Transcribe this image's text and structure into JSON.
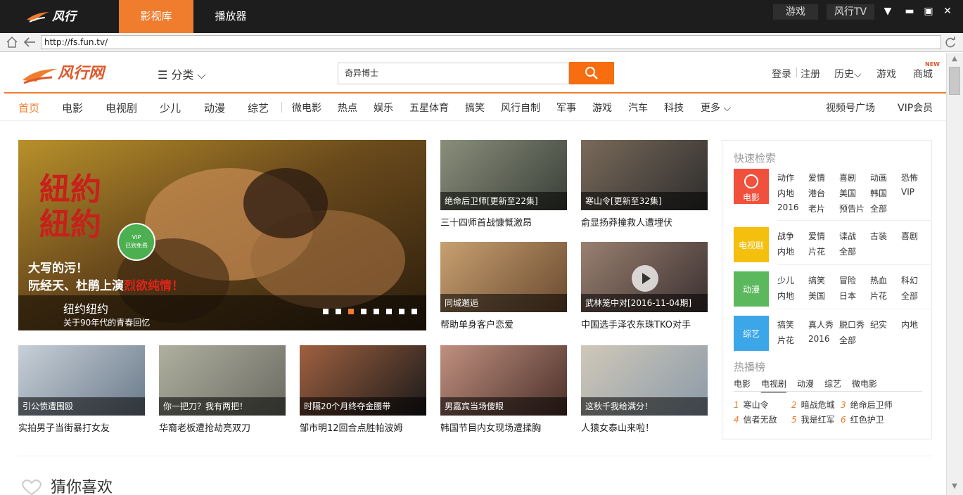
{
  "app": {
    "logo_text": "风行",
    "tabs": [
      "影视库",
      "播放器"
    ],
    "buttons": {
      "game": "游戏",
      "tv": "风行TV"
    }
  },
  "address": {
    "url": "http://fs.fun.tv/"
  },
  "site": {
    "logo_text": "风行网",
    "category_label": "☰ 分类 ⌵",
    "search_value": "奇异博士",
    "header_links": [
      "登录",
      "注册",
      "历史⌵",
      "游戏",
      "商城"
    ],
    "new_badge": "NEW",
    "nav_main": [
      "首页",
      "电影",
      "电视剧",
      "少儿",
      "动漫",
      "综艺"
    ],
    "nav_sub": [
      "微电影",
      "热点",
      "娱乐",
      "五星体育",
      "搞笑",
      "风行自制",
      "军事",
      "游戏",
      "汽车",
      "科技",
      "更多 ⌵"
    ],
    "nav_right": [
      "视频号广场",
      "VIP会员"
    ]
  },
  "hero": {
    "title": "纽约纽约",
    "subtitle": "关于90年代的青春回忆",
    "overlay_title": "紐約紐約",
    "overlay_text_1": "大写的污！",
    "overlay_text_2": "阮经天、杜鹃上演",
    "overlay_text_3": "烈欲纯情！",
    "vip_badge": "VIP 已到免费",
    "slide_count": 8,
    "active_slide": 3
  },
  "cards": [
    {
      "caption": "绝命后卫师[更新至22集]",
      "title": "三十四师首战慷慨激昂"
    },
    {
      "caption": "寒山令[更新至32集]",
      "title": "俞显扬莽撞救人遭埋伏"
    },
    {
      "caption": "同城邂逅",
      "title": "帮助单身客户恋爱"
    },
    {
      "caption": "武林笼中对[2016-11-04期]",
      "title": "中国选手泽农东珠TKO对手"
    },
    {
      "caption": "引公愤遭围殴",
      "title": "实拍男子当街暴打女友"
    },
    {
      "caption": "你一把刀？我有两把！",
      "title": "华裔老板遭抢劫亮双刀"
    },
    {
      "caption": "时隔20个月终夺金腰带",
      "title": "邹市明12回合点胜帕波姆"
    },
    {
      "caption": "男嘉宾当场傻眼",
      "title": "韩国节目内女现场遭揉胸"
    },
    {
      "caption": "这秋千我给满分！",
      "title": "人猿女泰山来啦！"
    }
  ],
  "quick_search": {
    "title": "快速检索",
    "rows": [
      {
        "label": "电影",
        "color": "#f0503c",
        "tags": [
          "动作",
          "爱情",
          "喜剧",
          "动画",
          "恐怖",
          "内地",
          "港台",
          "美国",
          "韩国",
          "VIP",
          "2016",
          "老片",
          "预告片",
          "全部"
        ]
      },
      {
        "label": "电视剧",
        "color": "#f5bf0e",
        "tags": [
          "战争",
          "爱情",
          "谍战",
          "古装",
          "喜剧",
          "内地",
          "片花",
          "全部"
        ]
      },
      {
        "label": "动漫",
        "color": "#5cb85c",
        "tags": [
          "少儿",
          "搞笑",
          "冒险",
          "热血",
          "科幻",
          "内地",
          "美国",
          "日本",
          "片花",
          "全部"
        ]
      },
      {
        "label": "综艺",
        "color": "#3ba6e8",
        "tags": [
          "搞笑",
          "真人秀",
          "脱口秀",
          "纪实",
          "内地",
          "片花",
          "2016",
          "全部"
        ]
      }
    ]
  },
  "hot": {
    "title": "热播榜",
    "tabs": [
      "电影",
      "电视剧",
      "动漫",
      "综艺",
      "微电影"
    ],
    "active_tab": 1,
    "items": [
      {
        "rank": "1",
        "name": "寒山令"
      },
      {
        "rank": "2",
        "name": "暗战危城"
      },
      {
        "rank": "3",
        "name": "绝命后卫师"
      },
      {
        "rank": "4",
        "name": "信者无敌"
      },
      {
        "rank": "5",
        "name": "我是红军"
      },
      {
        "rank": "6",
        "name": "红色护卫"
      }
    ]
  },
  "recommend": {
    "title": "猜你喜欢"
  }
}
